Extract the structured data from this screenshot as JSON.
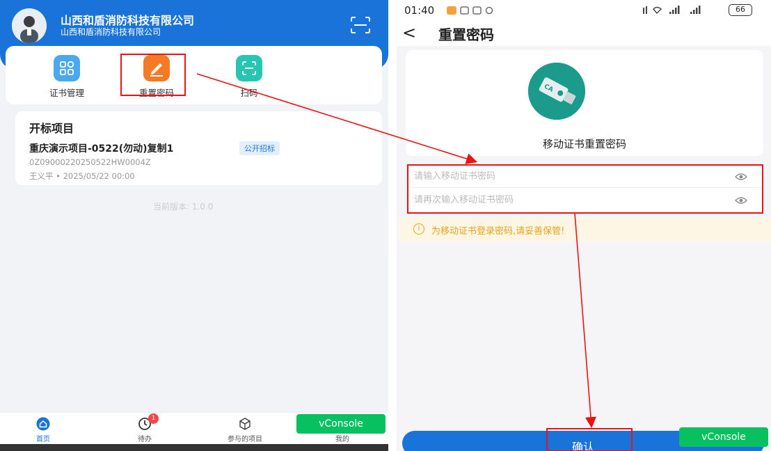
{
  "left": {
    "company": {
      "name": "山西和盾消防科技有限公司",
      "sub": "山西和盾消防科技有限公司"
    },
    "quick_actions": [
      {
        "label": "证书管理",
        "icon": "grid-icon"
      },
      {
        "label": "重置密码",
        "icon": "pencil-icon"
      },
      {
        "label": "扫码",
        "icon": "scan-icon"
      }
    ],
    "project": {
      "section_title": "开标项目",
      "title": "重庆演示项目-0522(勿动)复制1",
      "badge": "公开招标",
      "code": "0Z09000220250522HW0004Z",
      "meta": "王义平 • 2025/05/22 00:00"
    },
    "version": "当前版本: 1.0.0",
    "nav": [
      {
        "label": "首页",
        "icon": "home-icon"
      },
      {
        "label": "待办",
        "icon": "clock-icon",
        "badge": "1"
      },
      {
        "label": "参与的项目",
        "icon": "cube-icon"
      },
      {
        "label": "我的",
        "icon": "user-icon"
      }
    ],
    "vconsole": "vConsole"
  },
  "right": {
    "status": {
      "time": "01:40",
      "battery": "66"
    },
    "back": "<",
    "title": "重置密码",
    "hero_title": "移动证书重置密码",
    "password_placeholder": "请输入移动证书密码",
    "confirm_placeholder": "请再次输入移动证书密码",
    "tip_icon": "i",
    "tip": "为移动证书登录密码,请妥善保管!",
    "confirm_button": "确认",
    "vconsole": "vConsole"
  },
  "colors": {
    "primary": "#1a73d9",
    "orange": "#f47a23",
    "teal": "#27c6b2",
    "ca_green": "#1a9b8c",
    "highlight_red": "#e11111",
    "vconsole_green": "#07c160",
    "tip_amber": "#e8a31b"
  }
}
